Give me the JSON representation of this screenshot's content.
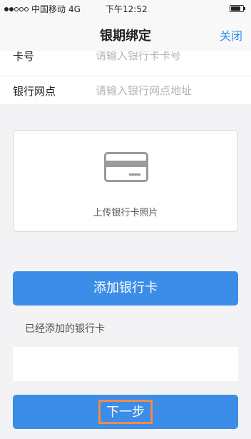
{
  "status_bar": {
    "carrier": "中国移动",
    "network": "4G",
    "time": "下午12:52",
    "signal_level": 2,
    "battery_level": 0.8
  },
  "nav": {
    "title": "银期绑定",
    "close_label": "关闭"
  },
  "form": {
    "card_number": {
      "label": "卡号",
      "placeholder": "请输入银行卡卡号"
    },
    "bank_branch": {
      "label": "银行网点",
      "placeholder": "请输入银行网点地址"
    }
  },
  "upload": {
    "icon": "bank-card-icon",
    "label": "上传银行卡照片"
  },
  "add_card_button": "添加银行卡",
  "added_section_label": "已经添加的银行卡",
  "next_button": "下一步",
  "colors": {
    "accent": "#3b8de8",
    "link": "#2b8ef0",
    "highlight": "#f08a4b"
  }
}
